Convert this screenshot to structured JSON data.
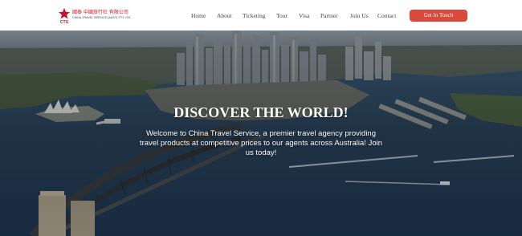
{
  "brand": {
    "logo_mark": "CTS",
    "name_cn": "國泰 中國旅行社 有限公司",
    "name_en": "CHINA TRAVEL SERVICE (AUST) PTY LTD",
    "color": "#c8102e"
  },
  "nav": {
    "items": [
      {
        "label": "Home"
      },
      {
        "label": "About"
      },
      {
        "label": "Ticketing"
      },
      {
        "label": "Tour"
      },
      {
        "label": "Visa"
      },
      {
        "label": "Partner"
      },
      {
        "label": "Join Us"
      },
      {
        "label": "Contact"
      }
    ],
    "cta_label": "Get In Touch",
    "cta_color": "#d94a3d"
  },
  "hero": {
    "title": "DISCOVER THE WORLD!",
    "subtitle": "Welcome to China Travel Service, a premier travel agency providing travel products at competitive prices to our agents across Australia! Join us today!"
  }
}
